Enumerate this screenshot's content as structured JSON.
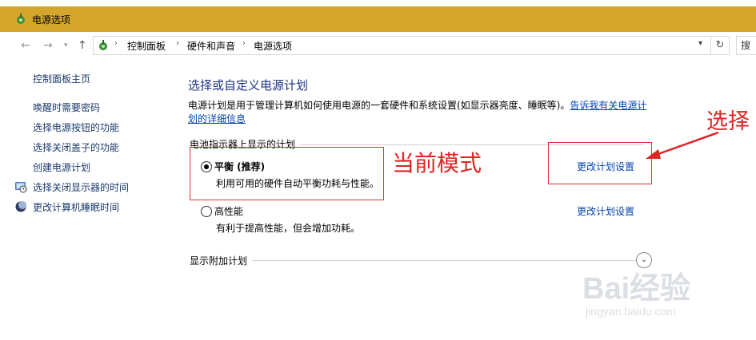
{
  "window": {
    "title": "电源选项"
  },
  "address": {
    "crumbs": [
      "控制面板",
      "硬件和声音",
      "电源选项"
    ],
    "refresh_icon": "refresh-icon",
    "search_text": "搜"
  },
  "sidebar": {
    "home": "控制面板主页",
    "items": [
      {
        "label": "唤醒时需要密码"
      },
      {
        "label": "选择电源按钮的功能"
      },
      {
        "label": "选择关闭盖子的功能"
      },
      {
        "label": "创建电源计划"
      },
      {
        "label": "选择关闭显示器的时间",
        "icon": "monitor-clock-icon"
      },
      {
        "label": "更改计算机睡眠时间",
        "icon": "moon-icon"
      }
    ]
  },
  "main": {
    "title": "选择或自定义电源计划",
    "description": "电源计划是用于管理计算机如何使用电源的一套硬件和系统设置(如显示器亮度、睡眠等)。",
    "learn_more_1": "告诉我有关电源计",
    "learn_more_2": "划的详细信息",
    "group_label": "电池指示器上显示的计划",
    "plans": [
      {
        "name": "平衡 (推荐)",
        "description": "利用可用的硬件自动平衡功耗与性能。",
        "selected": true,
        "link": "更改计划设置"
      },
      {
        "name": "高性能",
        "description": "有利于提高性能，但会增加功耗。",
        "selected": false,
        "link": "更改计划设置"
      }
    ],
    "extra_label": "显示附加计划"
  },
  "annotations": {
    "current_mode": "当前模式",
    "choose": "选择",
    "color": "#e02525"
  },
  "watermark": {
    "text": "Bai经验",
    "sub": "jingyan.baidu.com"
  },
  "colors": {
    "titlebar": "#d4a72c",
    "link": "#0645ad",
    "heading": "#1e3287"
  }
}
